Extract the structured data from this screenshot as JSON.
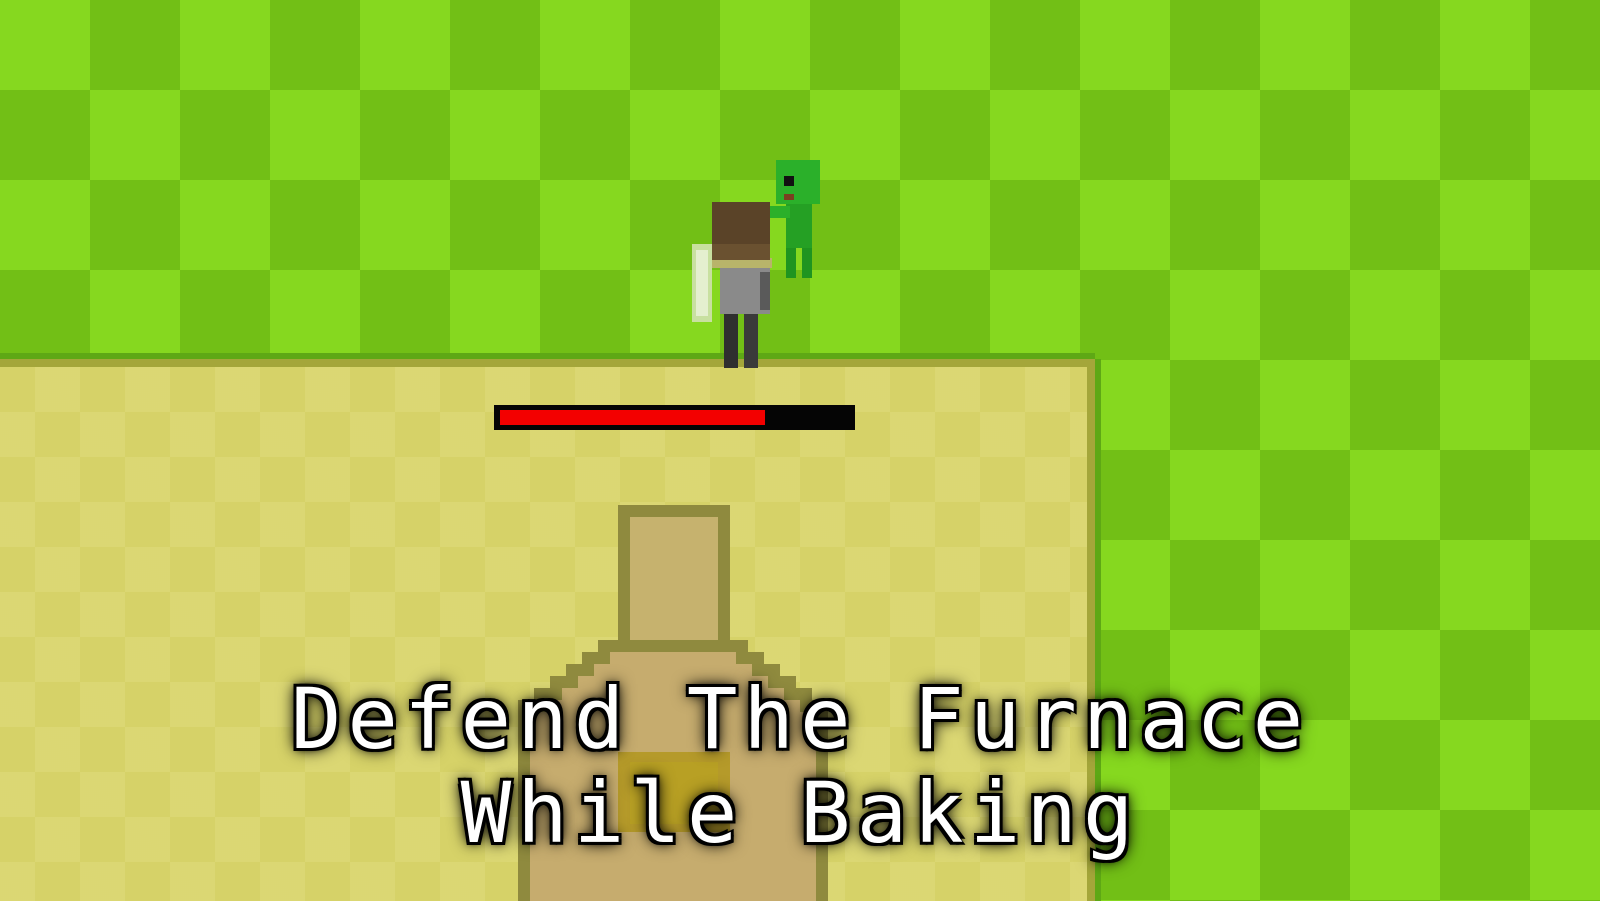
{
  "game": {
    "title_line_1": "Defend The Furnace",
    "title_line_2": "While Baking"
  },
  "furnace": {
    "health_fraction": 0.76
  },
  "colors": {
    "grass_light": "#86d81f",
    "grass_dark": "#72bf16",
    "sand": "#d6d268",
    "sand_border": "#a4a63a",
    "health_fill": "#f30000",
    "health_track": "#050505",
    "enemy_green": "#2bb02a",
    "title_text": "#ffffff"
  },
  "sprites": {
    "player": "player-with-shield-icon",
    "enemy": "green-zombie-icon",
    "furnace": "furnace-icon"
  }
}
